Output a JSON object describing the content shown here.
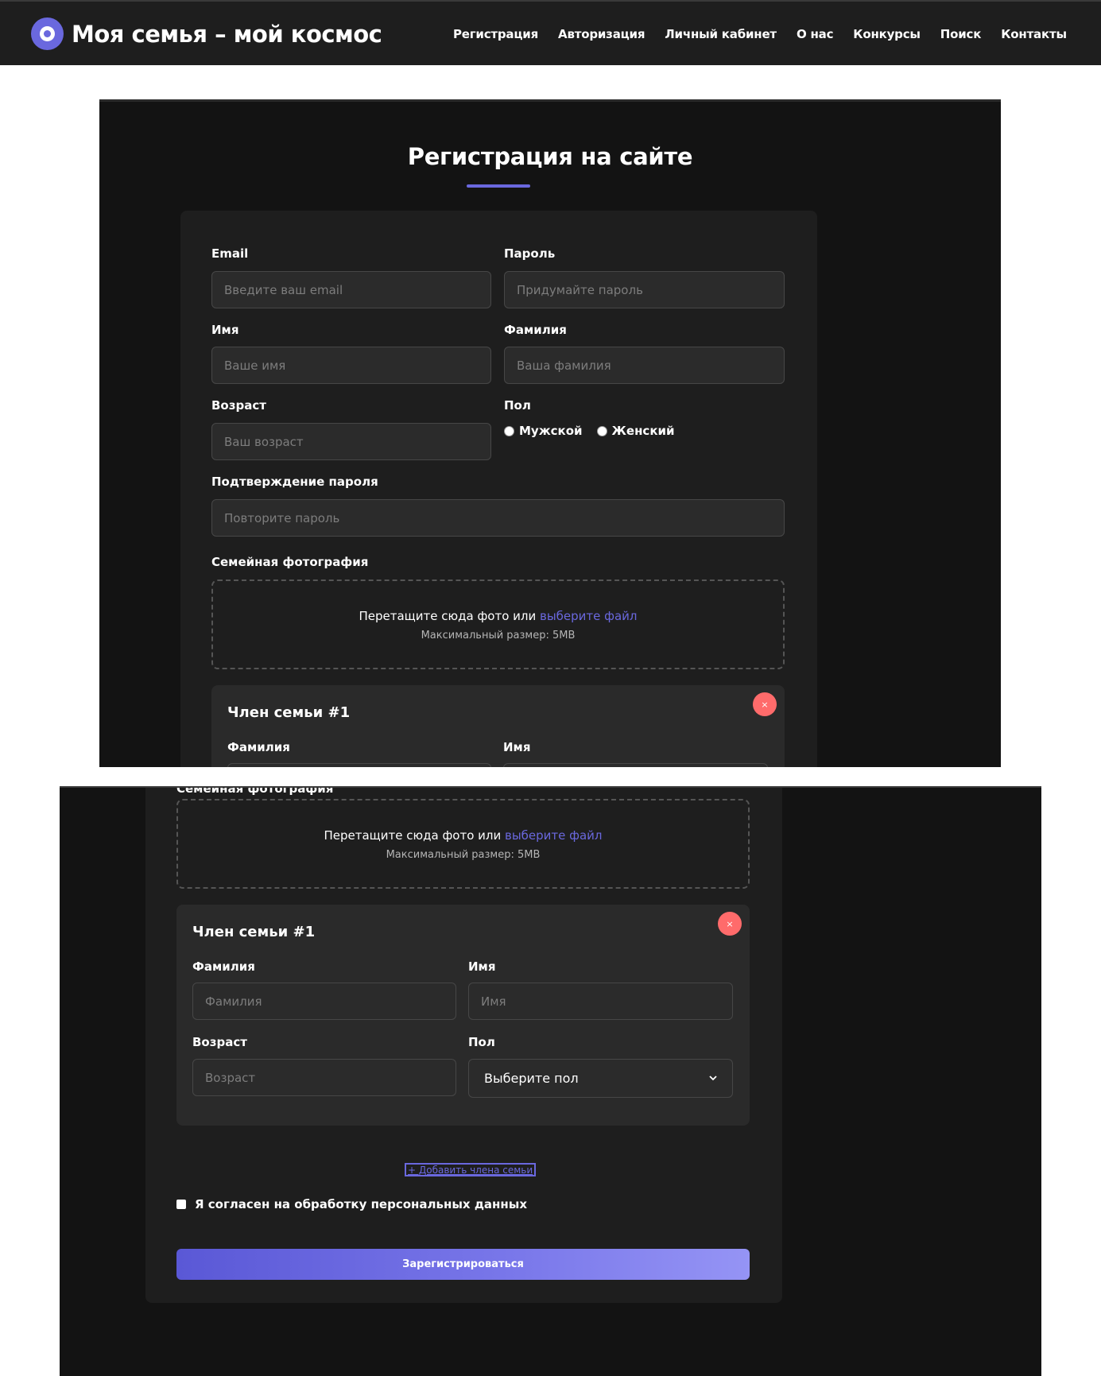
{
  "header": {
    "site_title": "Моя семья – мой космос",
    "nav": [
      "Регистрация",
      "Авторизация",
      "Личный кабинет",
      "О нас",
      "Конкурсы",
      "Поиск",
      "Контакты"
    ]
  },
  "form": {
    "heading": "Регистрация на сайте",
    "email": {
      "label": "Email",
      "placeholder": "Введите ваш email"
    },
    "password": {
      "label": "Пароль",
      "placeholder": "Придумайте пароль"
    },
    "first_name": {
      "label": "Имя",
      "placeholder": "Ваше имя"
    },
    "last_name": {
      "label": "Фамилия",
      "placeholder": "Ваша фамилия"
    },
    "age": {
      "label": "Возраст",
      "placeholder": "Ваш возраст"
    },
    "gender": {
      "label": "Пол",
      "options": [
        "Мужской",
        "Женский"
      ]
    },
    "confirm_password": {
      "label": "Подтверждение пароля",
      "placeholder": "Повторите пароль"
    },
    "photo": {
      "label": "Семейная фотография",
      "drop_text": "Перетащите сюда фото или ",
      "drop_link": "выберите файл",
      "max_size": "Максимальный размер: 5MB"
    },
    "member": {
      "title": "Член семьи #1",
      "remove_symbol": "×",
      "last_name": {
        "label": "Фамилия",
        "placeholder": "Фамилия"
      },
      "first_name": {
        "label": "Имя",
        "placeholder": "Имя"
      },
      "age": {
        "label": "Возраст",
        "placeholder": "Возраст"
      },
      "gender": {
        "label": "Пол",
        "selected": "Выберите пол"
      }
    },
    "add_member": "+ Добавить члена семьи",
    "consent": "Я согласен на обработку персональных данных",
    "submit": "Зарегистрироваться"
  },
  "colors": {
    "accent": "#6a68de",
    "background": "#131313",
    "card": "#1e1e1e",
    "remove": "#ff6b6b"
  }
}
